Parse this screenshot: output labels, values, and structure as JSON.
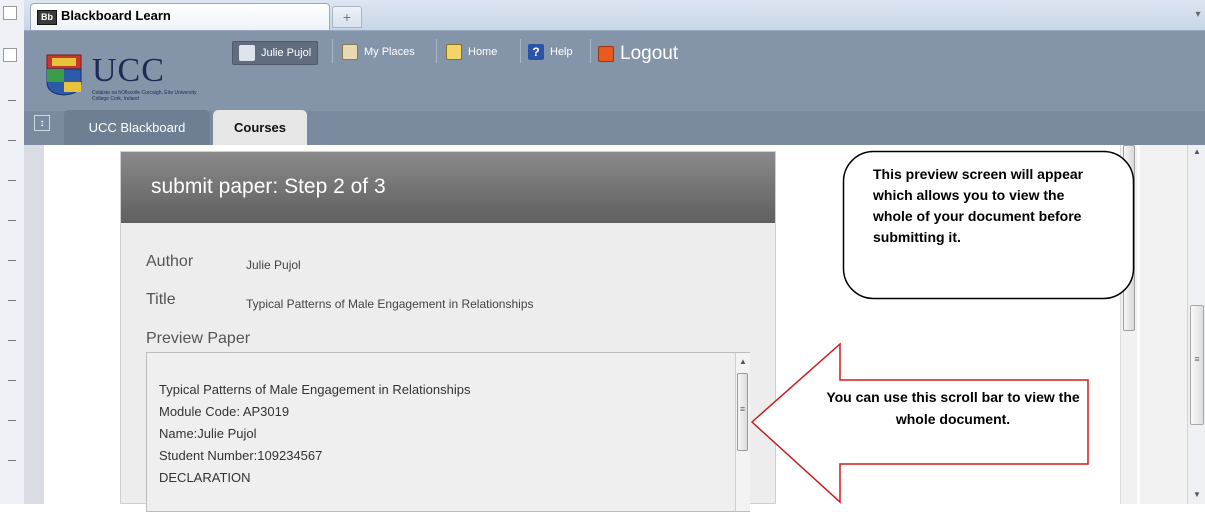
{
  "browser": {
    "favicon_text": "Bb",
    "tab_title": "Blackboard Learn",
    "new_tab_glyph": "+"
  },
  "header": {
    "logo_text": "UCC",
    "logo_subtext": "Coláiste na hOllscoile Corcaigh, Éire  University College Cork, Ireland",
    "user_name": "Julie Pujol",
    "links": {
      "my_places": "My Places",
      "home": "Home",
      "help": "Help",
      "logout": "Logout"
    },
    "tabs": {
      "ucc_blackboard": "UCC Blackboard",
      "courses": "Courses"
    }
  },
  "submission": {
    "title": "submit paper: Step 2 of 3",
    "author_label": "Author",
    "author_value": "Julie Pujol",
    "title_label": "Title",
    "title_value": "Typical Patterns of Male Engagement in Relationships",
    "preview_label": "Preview Paper",
    "preview_lines": [
      "Typical Patterns of Male Engagement in Relationships",
      "Module Code: AP3019",
      "Name:Julie Pujol",
      "Student Number:109234567",
      "DECLARATION"
    ]
  },
  "annotations": {
    "callout": "This preview screen will appear which allows you to view the whole of your document before submitting it.",
    "arrow": "You can use this scroll bar to view the whole document."
  },
  "colors": {
    "header_bg": "#8494a9",
    "card_header": "#6e6e6e",
    "arrow_stroke": "#d11a1a"
  }
}
